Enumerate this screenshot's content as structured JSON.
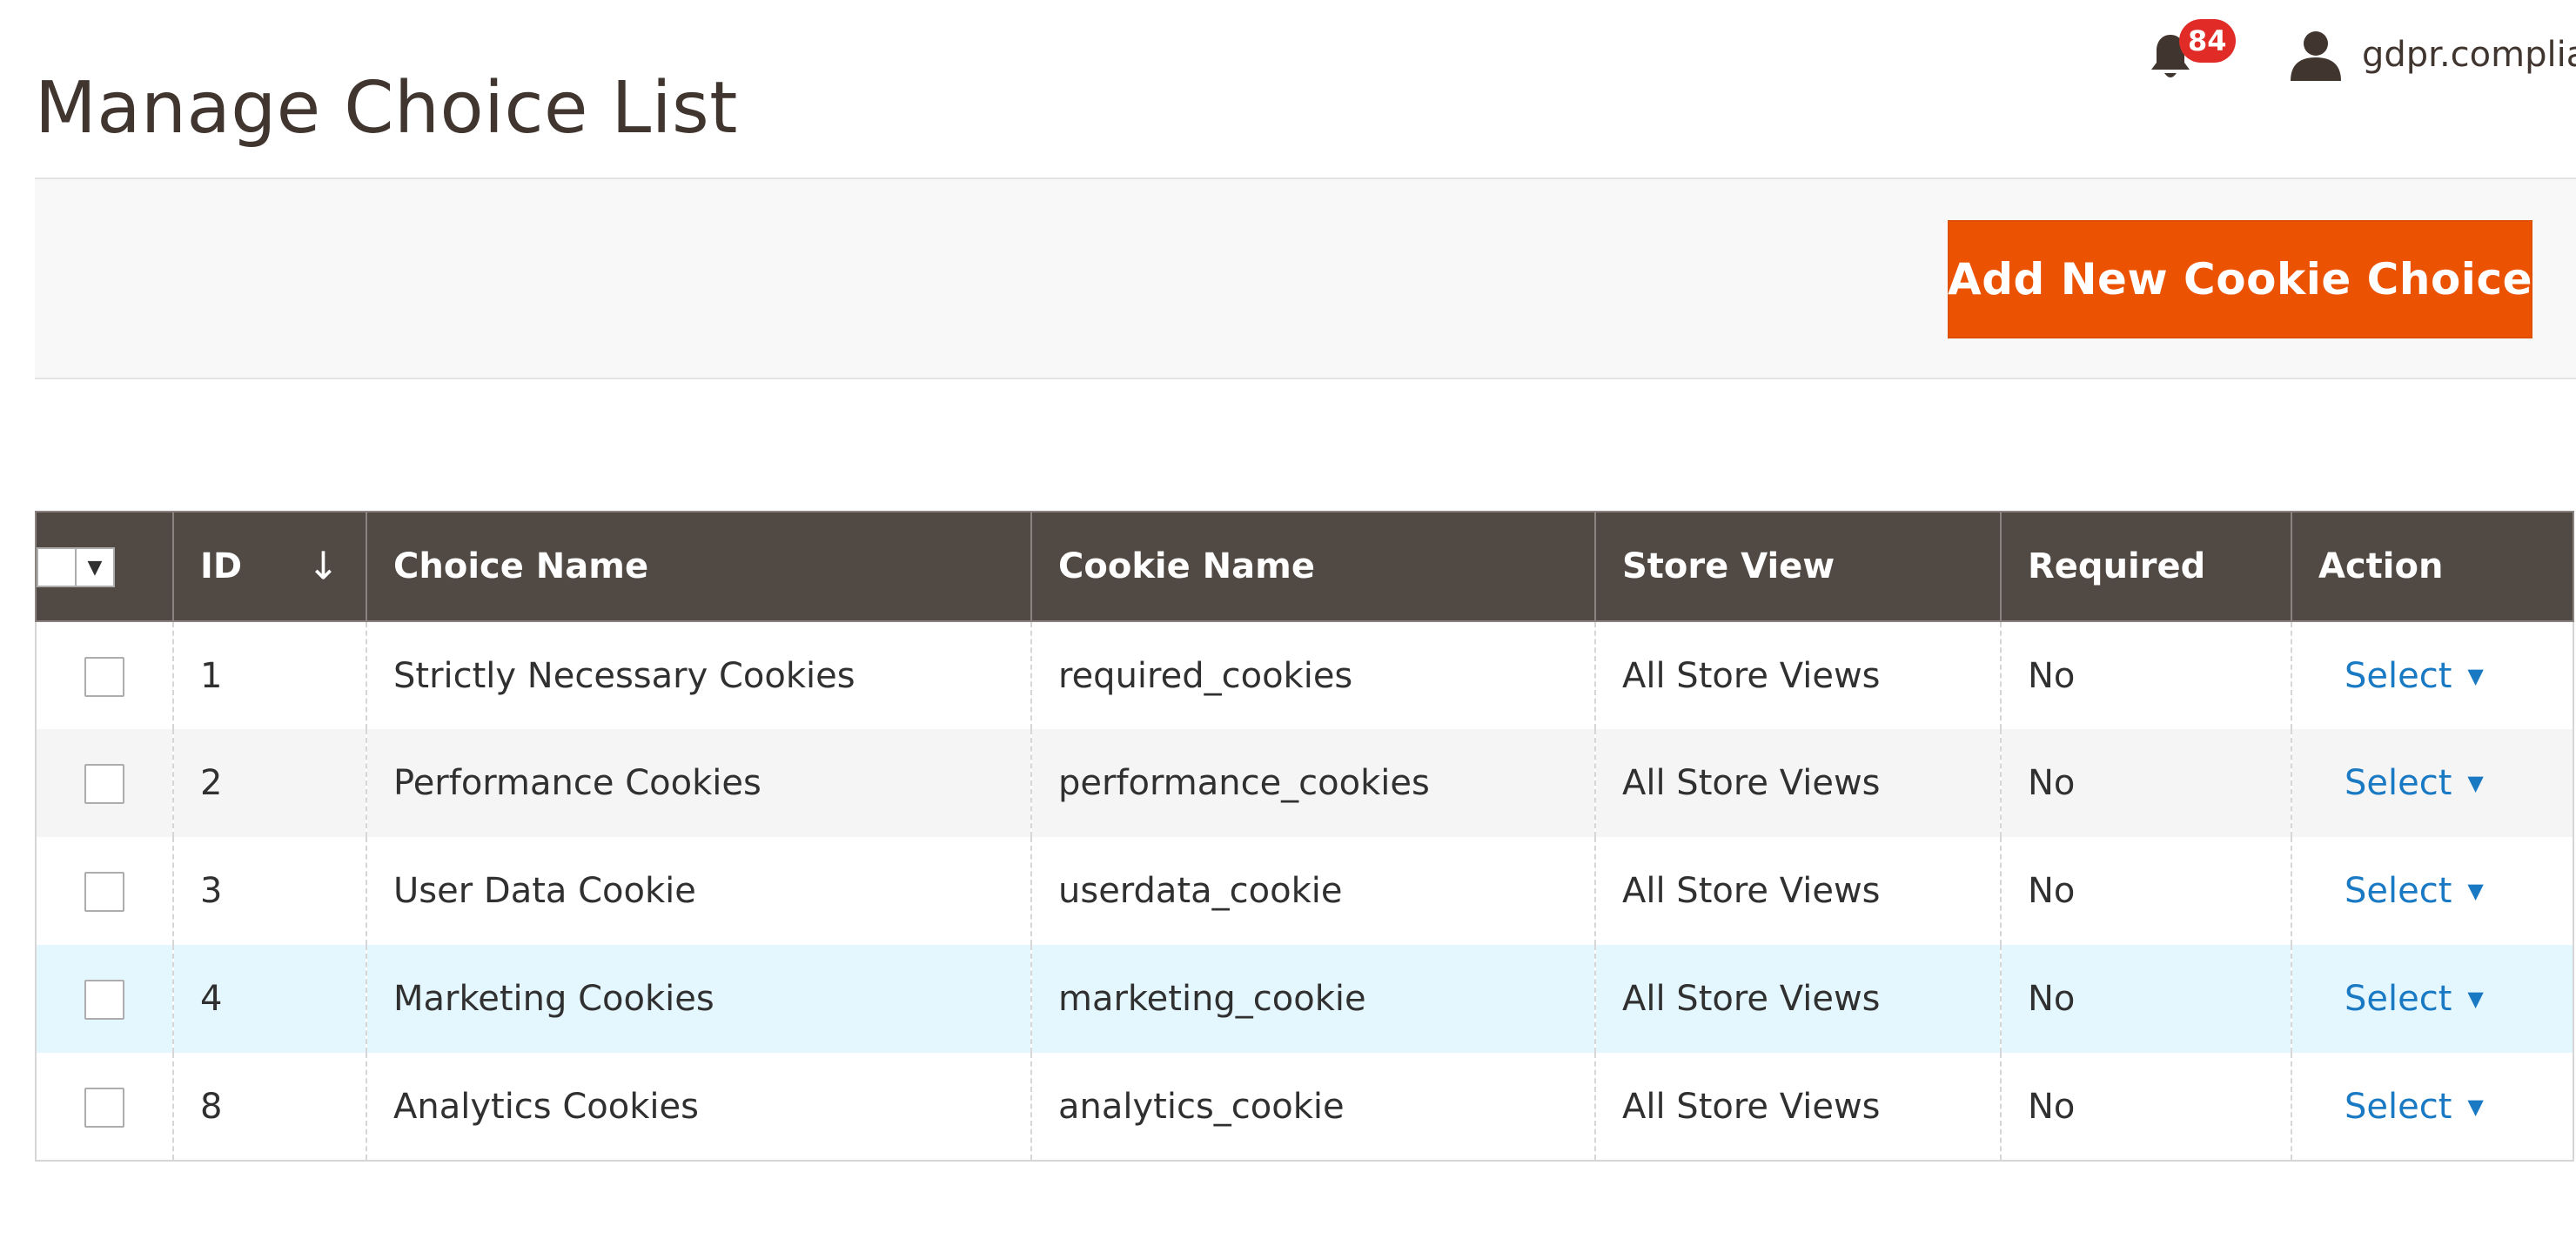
{
  "page": {
    "title": "Manage Choice List"
  },
  "header": {
    "notification_count": "84",
    "user_name": "gdpr.compliance"
  },
  "toolbar": {
    "add_button_label": "Add New Cookie Choice"
  },
  "grid": {
    "columns": [
      "ID",
      "Choice Name",
      "Cookie Name",
      "Store View",
      "Required",
      "Action"
    ],
    "sort_indicator": "↓",
    "rows": [
      {
        "id": "1",
        "choice_name": "Strictly Necessary Cookies",
        "cookie_name": "required_cookies",
        "store_view": "All Store Views",
        "required": "No",
        "action": "Select"
      },
      {
        "id": "2",
        "choice_name": "Performance Cookies",
        "cookie_name": "performance_cookies",
        "store_view": "All Store Views",
        "required": "No",
        "action": "Select"
      },
      {
        "id": "3",
        "choice_name": "User Data Cookie",
        "cookie_name": "userdata_cookie",
        "store_view": "All Store Views",
        "required": "No",
        "action": "Select"
      },
      {
        "id": "4",
        "choice_name": "Marketing Cookies",
        "cookie_name": "marketing_cookie",
        "store_view": "All Store Views",
        "required": "No",
        "action": "Select"
      },
      {
        "id": "8",
        "choice_name": "Analytics Cookies",
        "cookie_name": "analytics_cookie",
        "store_view": "All Store Views",
        "required": "No",
        "action": "Select"
      }
    ]
  },
  "colors": {
    "primary_button": "#eb5202",
    "table_header": "#514943",
    "link": "#1979c3",
    "badge": "#e02b27",
    "row_highlight": "#e5f7fe"
  }
}
